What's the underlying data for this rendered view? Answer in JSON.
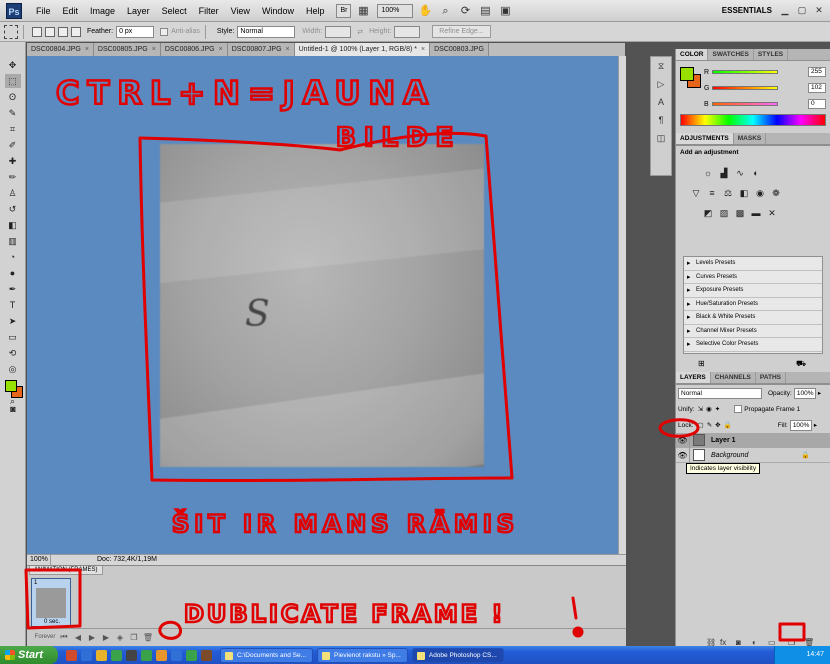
{
  "app": {
    "logo": "Ps",
    "menu": [
      "File",
      "Edit",
      "Image",
      "Layer",
      "Select",
      "Filter",
      "View",
      "Window",
      "Help"
    ],
    "bridge_label": "Br",
    "zoom_select": "100%",
    "workspace": "ESSENTIALS"
  },
  "options_bar": {
    "feather_label": "Feather:",
    "feather_value": "0 px",
    "antialias_label": "Anti-alias",
    "style_label": "Style:",
    "style_value": "Normal",
    "width_label": "Width:",
    "height_label": "Height:",
    "refine_edge": "Refine Edge..."
  },
  "document_tabs": [
    {
      "label": "DSC00804.JPG",
      "active": false
    },
    {
      "label": "DSC00805.JPG",
      "active": false
    },
    {
      "label": "DSC00806.JPG",
      "active": false
    },
    {
      "label": "DSC00807.JPG",
      "active": false
    },
    {
      "label": "Untitled-1 @ 100% (Layer 1, RGB/8) *",
      "active": true
    },
    {
      "label": "DSC00803.JPG",
      "active": false
    }
  ],
  "status": {
    "zoom": "100%",
    "doc_info": "Doc: 732,4K/1,19M"
  },
  "animation": {
    "tab_label": "ANIMATION (FRAMES)",
    "frame_number": "1",
    "frame_delay": "0 sec.",
    "loop": "Forever"
  },
  "annotations": {
    "line1": "CTRL+N=JAUNA",
    "line2": "BILDE",
    "line3": "ŠIT IR MANS RĀMIS",
    "line4": "DUBLICATE FRAME !"
  },
  "color_panel": {
    "tabs": [
      "COLOR",
      "SWATCHES",
      "STYLES"
    ],
    "foreground": "#98e000",
    "background": "#e5651a",
    "channels": [
      {
        "label": "R",
        "value": "255"
      },
      {
        "label": "G",
        "value": "102"
      },
      {
        "label": "B",
        "value": "0"
      }
    ]
  },
  "adjustments_panel": {
    "tabs": [
      "ADJUSTMENTS",
      "MASKS"
    ],
    "title": "Add an adjustment",
    "presets": [
      "Levels Presets",
      "Curves Presets",
      "Exposure Presets",
      "Hue/Saturation Presets",
      "Black & White Presets",
      "Channel Mixer Presets",
      "Selective Color Presets"
    ]
  },
  "layers_panel": {
    "tabs": [
      "LAYERS",
      "CHANNELS",
      "PATHS"
    ],
    "blend_mode": "Normal",
    "opacity_label": "Opacity:",
    "opacity_value": "100%",
    "unify_label": "Unify:",
    "propagate_label": "Propagate Frame 1",
    "lock_label": "Lock:",
    "fill_label": "Fill:",
    "fill_value": "100%",
    "layers": [
      {
        "name": "Layer 1",
        "active": true
      },
      {
        "name": "Background",
        "active": false
      }
    ],
    "tooltip": "Indicates layer visibility"
  },
  "taskbar": {
    "start": "Start",
    "tasks": [
      {
        "label": "C:\\Documents and Se...",
        "active": false
      },
      {
        "label": "Pievienot rakstu » Sp...",
        "active": false
      },
      {
        "label": "Adobe Photoshop CS...",
        "active": true
      }
    ],
    "clock": "14:47"
  },
  "colors": {
    "canvas_bg": "#5b8ac0",
    "annotation": "#e00000",
    "panel": "#cfcfcf"
  }
}
